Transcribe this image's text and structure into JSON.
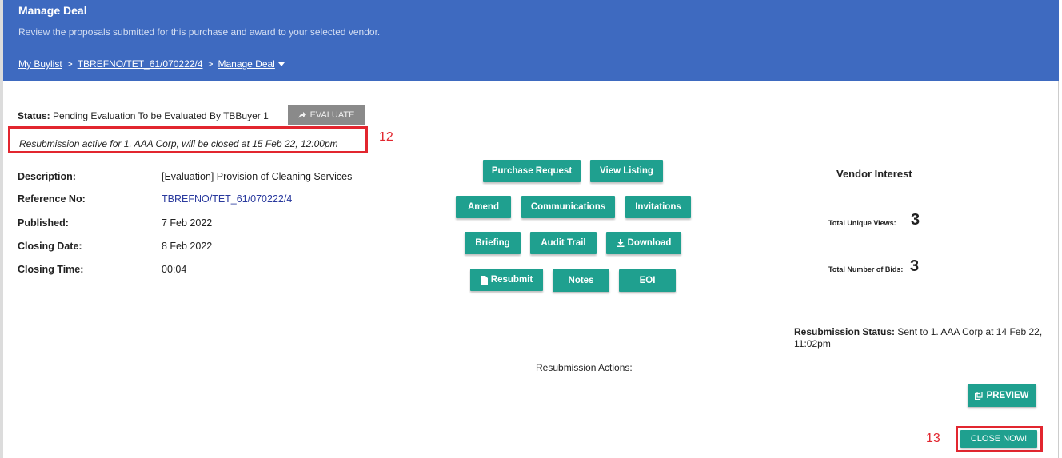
{
  "header": {
    "title": "Manage Deal",
    "subtitle": "Review the proposals submitted for this purchase and award to your selected vendor.",
    "breadcrumb": {
      "item1": "My Buylist",
      "sep": ">",
      "item2": "TBREFNO/TET_61/070222/4",
      "item3": "Manage Deal"
    }
  },
  "status": {
    "label": "Status:",
    "value": "Pending Evaluation To be Evaluated By TBBuyer 1",
    "evaluate_button": "EVALUATE"
  },
  "resubmission_notice": "Resubmission active for 1. AAA Corp, will be closed at 15 Feb 22, 12:00pm",
  "annotations": {
    "a12": "12",
    "a13": "13"
  },
  "details": {
    "description_label": "Description:",
    "description_value": "[Evaluation] Provision of Cleaning Services",
    "reference_label": "Reference No:",
    "reference_value": "TBREFNO/TET_61/070222/4",
    "published_label": "Published:",
    "published_value": "7 Feb 2022",
    "closing_date_label": "Closing Date:",
    "closing_date_value": "8 Feb 2022",
    "closing_time_label": "Closing Time:",
    "closing_time_value": "00:04"
  },
  "buttons": {
    "purchase_request": "Purchase Request",
    "view_listing": "View Listing",
    "amend": "Amend",
    "communications": "Communications",
    "invitations": "Invitations",
    "briefing": "Briefing",
    "audit_trail": "Audit Trail",
    "download": "Download",
    "resubmit": "Resubmit",
    "notes": "Notes",
    "eoi": "EOI",
    "preview": "PREVIEW",
    "close_now": "CLOSE NOW!"
  },
  "vendor_interest": {
    "title": "Vendor Interest",
    "views_label": "Total Unique Views:",
    "views_value": "3",
    "bids_label": "Total Number of Bids:",
    "bids_value": "3"
  },
  "resubmission_status": {
    "label": "Resubmission Status:",
    "value": "Sent to 1. AAA Corp at 14 Feb 22, 11:02pm"
  },
  "resubmission_actions": "Resubmission Actions:",
  "colors": {
    "header": "#3e6ac0",
    "button": "#1fa08f",
    "annotation": "#e2262f",
    "disabled": "#8a8a8a"
  }
}
